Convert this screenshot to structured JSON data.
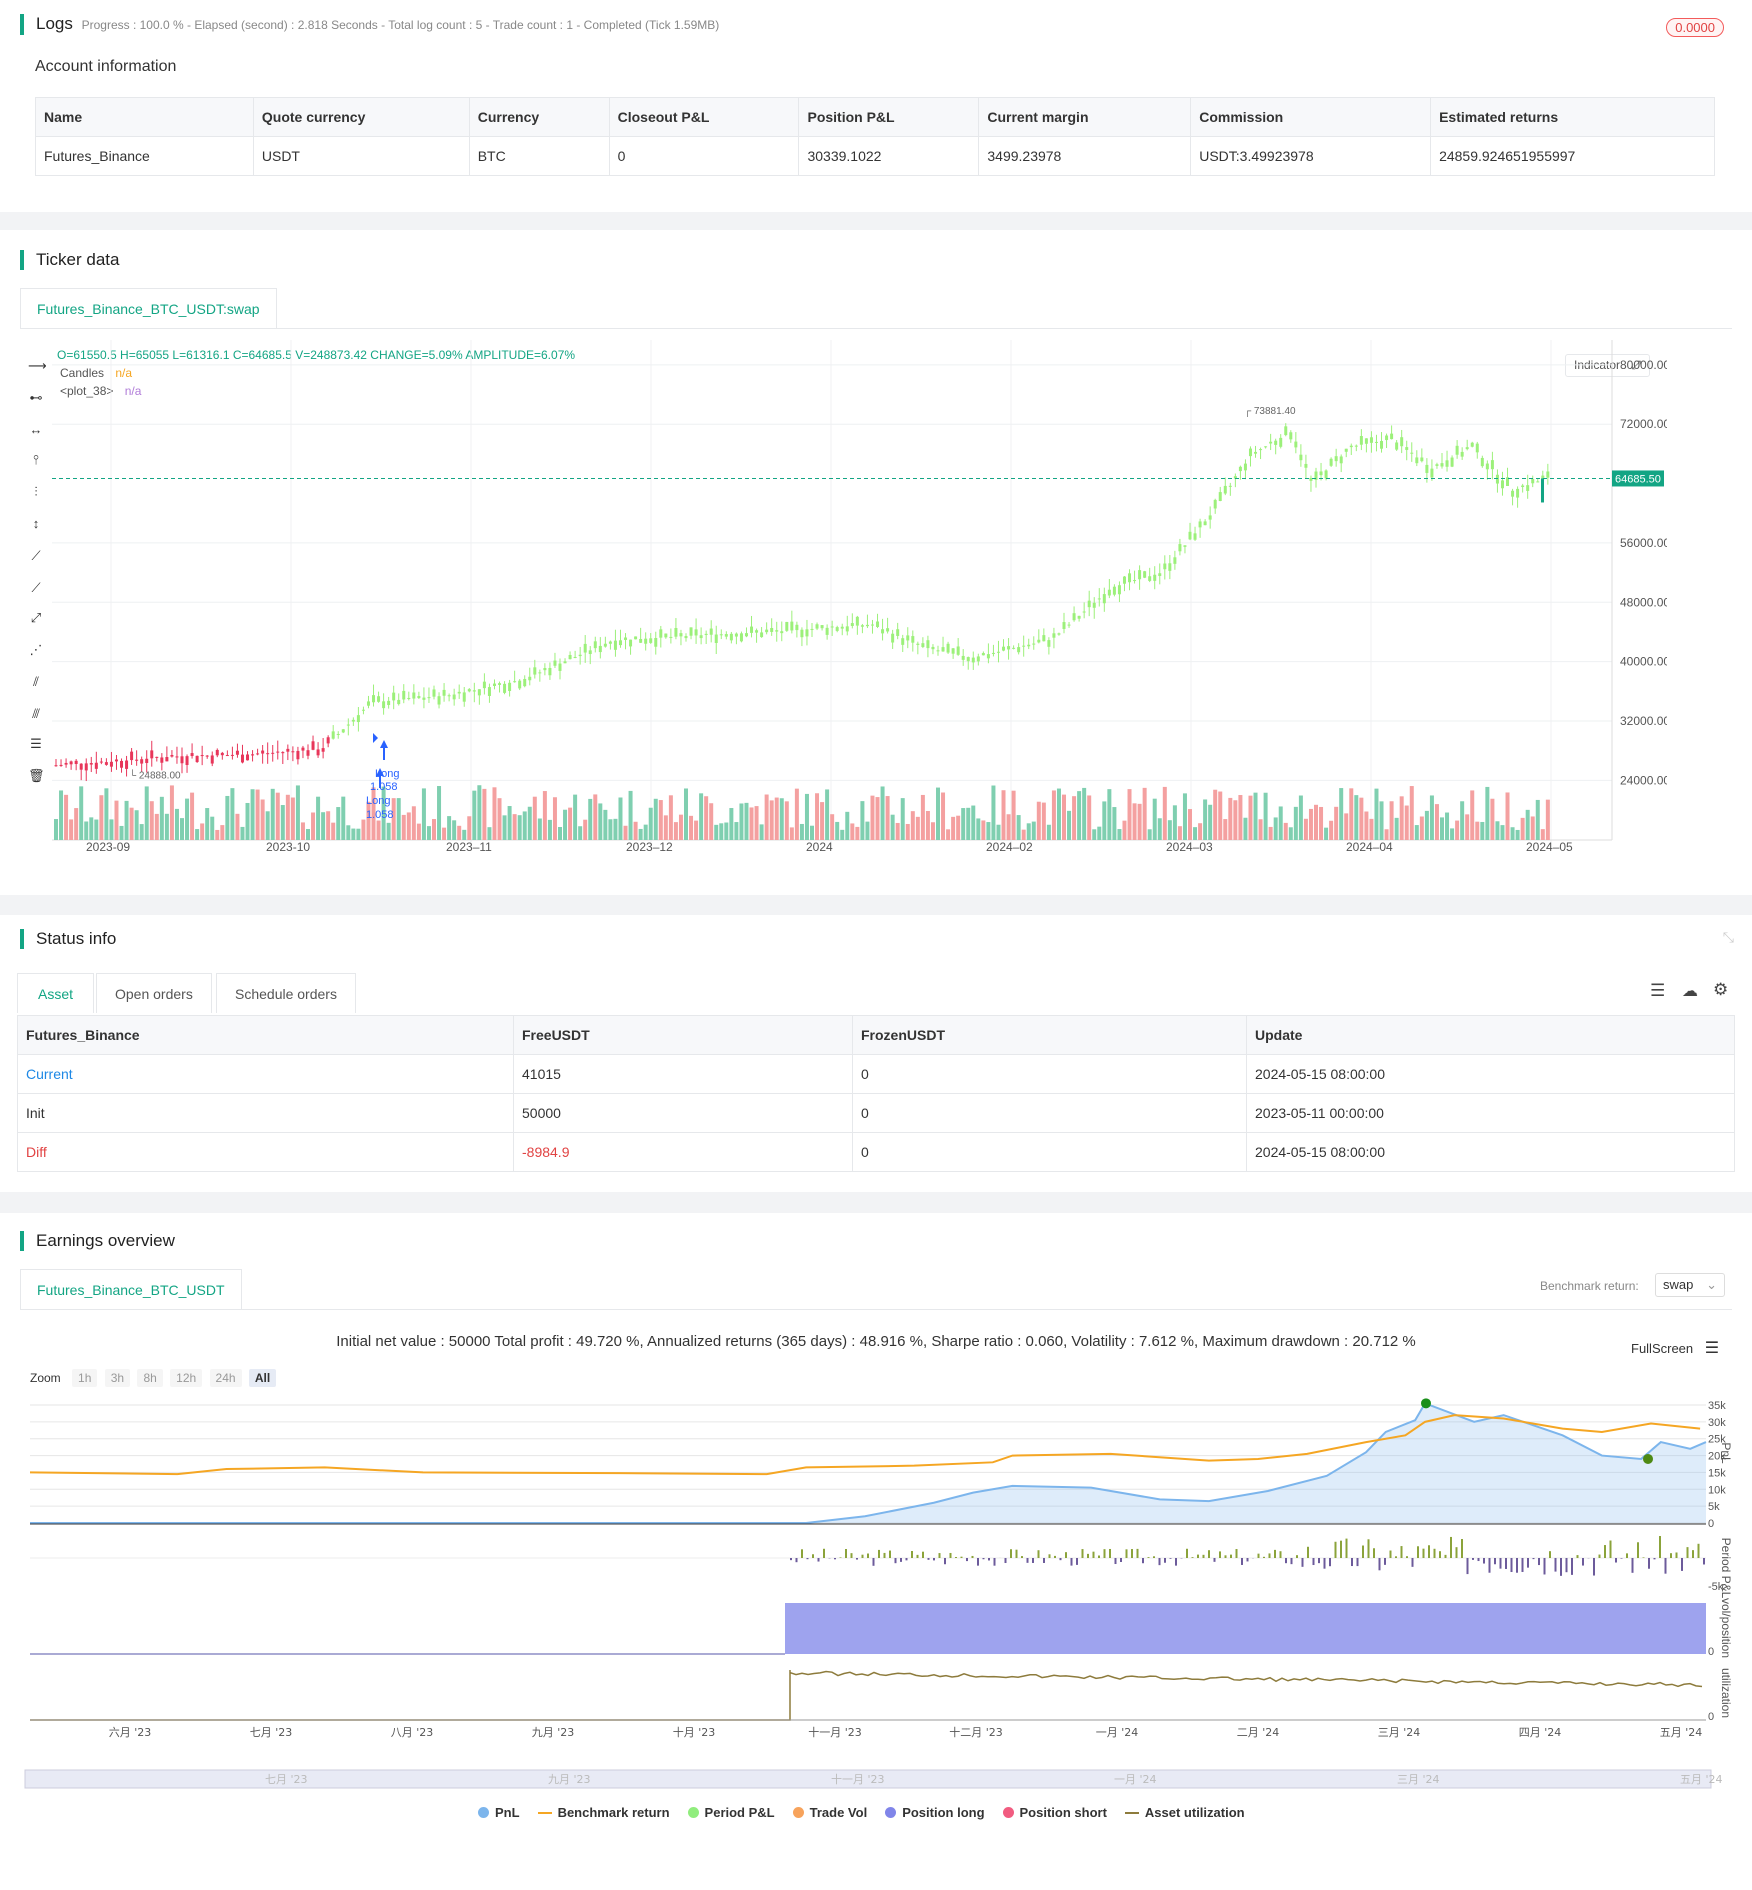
{
  "logs": {
    "title": "Logs",
    "summary": "Progress : 100.0 % - Elapsed (second) : 2.818  Seconds - Total log count : 5 - Trade count : 1 - Completed (Tick 1.59MB)",
    "badge": "0.0000"
  },
  "account": {
    "title": "Account information",
    "columns": [
      "Name",
      "Quote currency",
      "Currency",
      "Closeout P&L",
      "Position P&L",
      "Current margin",
      "Commission",
      "Estimated returns"
    ],
    "row": [
      "Futures_Binance",
      "USDT",
      "BTC",
      "0",
      "30339.1022",
      "3499.23978",
      "USDT:3.49923978",
      "24859.924651955997"
    ]
  },
  "ticker": {
    "title": "Ticker data",
    "tab": "Futures_Binance_BTC_USDT:swap",
    "ohlc": "O=61550.5 H=65055 L=61316.1 C=64685.5 V=248873.42 CHANGE=5.09% AMPLITUDE=6.07%",
    "legend1_name": "Candles",
    "legend1_val": "n/a",
    "legend2_name": "<plot_38>",
    "legend2_val": "n/a",
    "indicator_btn": "Indicator",
    "last_price": "64685.50",
    "high_marker": "73881.40",
    "low_marker": "24888.00",
    "trade_labels": [
      "Long",
      "1.058",
      "Long",
      "1.058"
    ],
    "y_ticks": [
      "80000.00",
      "72000.00",
      "56000.00",
      "48000.00",
      "40000.00",
      "32000.00",
      "24000.00"
    ],
    "x_ticks": [
      "2023-09",
      "2023-10",
      "2023–11",
      "2023–12",
      "2024",
      "2024–02",
      "2024–03",
      "2024–04",
      "2024–05"
    ],
    "colors": {
      "up": "#9cf07a",
      "down": "#f08080",
      "vol_up": "#7fcfb0",
      "vol_down": "#f4a0a0",
      "accent": "#13a584"
    }
  },
  "status": {
    "title": "Status info",
    "tabs": [
      "Asset",
      "Open orders",
      "Schedule orders"
    ],
    "columns": [
      "Futures_Binance",
      "FreeUSDT",
      "FrozenUSDT",
      "Update"
    ],
    "rows": [
      [
        "Current",
        "41015",
        "0",
        "2024-05-15 08:00:00"
      ],
      [
        "Init",
        "50000",
        "0",
        "2023-05-11 00:00:00"
      ],
      [
        "Diff",
        "-8984.9",
        "0",
        "2024-05-15 08:00:00"
      ]
    ]
  },
  "earnings": {
    "title": "Earnings overview",
    "tab": "Futures_Binance_BTC_USDT",
    "benchmark_label": "Benchmark return:",
    "benchmark_value": "swap",
    "summary": "Initial net value : 50000 Total profit : 49.720 %, Annualized returns (365 days) : 48.916 %, Sharpe ratio : 0.060, Volatility : 7.612 %, Maximum drawdown : 20.712 %",
    "fullscreen": "FullScreen",
    "zoom_label": "Zoom",
    "zoom_buttons": [
      "1h",
      "3h",
      "8h",
      "12h",
      "24h",
      "All"
    ],
    "pnl_ticks": [
      "35k",
      "30k",
      "25k",
      "20k",
      "15k",
      "10k",
      "5k",
      "0"
    ],
    "period_tick": "-5k",
    "vol_tick": "0",
    "util_tick": "0",
    "axis_titles": [
      "PnL",
      "Period P&L",
      "vol/position",
      "utilization"
    ],
    "x_ticks": [
      "六月 '23",
      "七月 '23",
      "八月 '23",
      "九月 '23",
      "十月 '23",
      "十一月 '23",
      "十二月 '23",
      "一月 '24",
      "二月 '24",
      "三月 '24",
      "四月 '24",
      "五月 '24"
    ],
    "nav_ticks": [
      "七月 '23",
      "九月 '23",
      "十一月 '23",
      "一月 '24",
      "三月 '24",
      "五月 '24"
    ],
    "legend": [
      {
        "name": "PnL",
        "color": "#7cb5ec"
      },
      {
        "name": "Benchmark return",
        "color": "#f5a623"
      },
      {
        "name": "Period P&L",
        "color": "#90ed7d"
      },
      {
        "name": "Trade Vol",
        "color": "#f7a35c"
      },
      {
        "name": "Position long",
        "color": "#8085e9"
      },
      {
        "name": "Position short",
        "color": "#f15c80"
      },
      {
        "name": "Asset utilization",
        "color": "#8d7b3c"
      }
    ]
  }
}
